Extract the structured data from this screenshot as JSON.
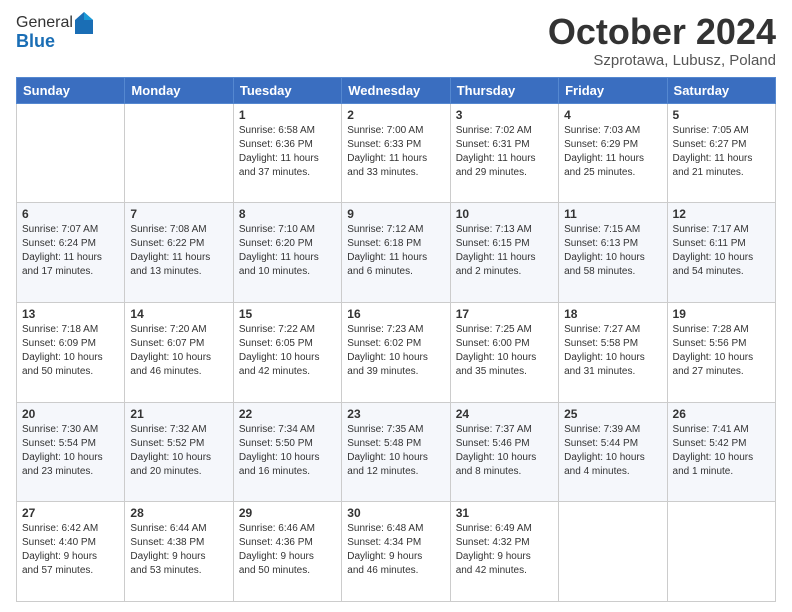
{
  "logo": {
    "general": "General",
    "blue": "Blue"
  },
  "header": {
    "month": "October 2024",
    "location": "Szprotawa, Lubusz, Poland"
  },
  "days": [
    "Sunday",
    "Monday",
    "Tuesday",
    "Wednesday",
    "Thursday",
    "Friday",
    "Saturday"
  ],
  "weeks": [
    [
      {
        "day": "",
        "content": ""
      },
      {
        "day": "",
        "content": ""
      },
      {
        "day": "1",
        "content": "Sunrise: 6:58 AM\nSunset: 6:36 PM\nDaylight: 11 hours\nand 37 minutes."
      },
      {
        "day": "2",
        "content": "Sunrise: 7:00 AM\nSunset: 6:33 PM\nDaylight: 11 hours\nand 33 minutes."
      },
      {
        "day": "3",
        "content": "Sunrise: 7:02 AM\nSunset: 6:31 PM\nDaylight: 11 hours\nand 29 minutes."
      },
      {
        "day": "4",
        "content": "Sunrise: 7:03 AM\nSunset: 6:29 PM\nDaylight: 11 hours\nand 25 minutes."
      },
      {
        "day": "5",
        "content": "Sunrise: 7:05 AM\nSunset: 6:27 PM\nDaylight: 11 hours\nand 21 minutes."
      }
    ],
    [
      {
        "day": "6",
        "content": "Sunrise: 7:07 AM\nSunset: 6:24 PM\nDaylight: 11 hours\nand 17 minutes."
      },
      {
        "day": "7",
        "content": "Sunrise: 7:08 AM\nSunset: 6:22 PM\nDaylight: 11 hours\nand 13 minutes."
      },
      {
        "day": "8",
        "content": "Sunrise: 7:10 AM\nSunset: 6:20 PM\nDaylight: 11 hours\nand 10 minutes."
      },
      {
        "day": "9",
        "content": "Sunrise: 7:12 AM\nSunset: 6:18 PM\nDaylight: 11 hours\nand 6 minutes."
      },
      {
        "day": "10",
        "content": "Sunrise: 7:13 AM\nSunset: 6:15 PM\nDaylight: 11 hours\nand 2 minutes."
      },
      {
        "day": "11",
        "content": "Sunrise: 7:15 AM\nSunset: 6:13 PM\nDaylight: 10 hours\nand 58 minutes."
      },
      {
        "day": "12",
        "content": "Sunrise: 7:17 AM\nSunset: 6:11 PM\nDaylight: 10 hours\nand 54 minutes."
      }
    ],
    [
      {
        "day": "13",
        "content": "Sunrise: 7:18 AM\nSunset: 6:09 PM\nDaylight: 10 hours\nand 50 minutes."
      },
      {
        "day": "14",
        "content": "Sunrise: 7:20 AM\nSunset: 6:07 PM\nDaylight: 10 hours\nand 46 minutes."
      },
      {
        "day": "15",
        "content": "Sunrise: 7:22 AM\nSunset: 6:05 PM\nDaylight: 10 hours\nand 42 minutes."
      },
      {
        "day": "16",
        "content": "Sunrise: 7:23 AM\nSunset: 6:02 PM\nDaylight: 10 hours\nand 39 minutes."
      },
      {
        "day": "17",
        "content": "Sunrise: 7:25 AM\nSunset: 6:00 PM\nDaylight: 10 hours\nand 35 minutes."
      },
      {
        "day": "18",
        "content": "Sunrise: 7:27 AM\nSunset: 5:58 PM\nDaylight: 10 hours\nand 31 minutes."
      },
      {
        "day": "19",
        "content": "Sunrise: 7:28 AM\nSunset: 5:56 PM\nDaylight: 10 hours\nand 27 minutes."
      }
    ],
    [
      {
        "day": "20",
        "content": "Sunrise: 7:30 AM\nSunset: 5:54 PM\nDaylight: 10 hours\nand 23 minutes."
      },
      {
        "day": "21",
        "content": "Sunrise: 7:32 AM\nSunset: 5:52 PM\nDaylight: 10 hours\nand 20 minutes."
      },
      {
        "day": "22",
        "content": "Sunrise: 7:34 AM\nSunset: 5:50 PM\nDaylight: 10 hours\nand 16 minutes."
      },
      {
        "day": "23",
        "content": "Sunrise: 7:35 AM\nSunset: 5:48 PM\nDaylight: 10 hours\nand 12 minutes."
      },
      {
        "day": "24",
        "content": "Sunrise: 7:37 AM\nSunset: 5:46 PM\nDaylight: 10 hours\nand 8 minutes."
      },
      {
        "day": "25",
        "content": "Sunrise: 7:39 AM\nSunset: 5:44 PM\nDaylight: 10 hours\nand 4 minutes."
      },
      {
        "day": "26",
        "content": "Sunrise: 7:41 AM\nSunset: 5:42 PM\nDaylight: 10 hours\nand 1 minute."
      }
    ],
    [
      {
        "day": "27",
        "content": "Sunrise: 6:42 AM\nSunset: 4:40 PM\nDaylight: 9 hours\nand 57 minutes."
      },
      {
        "day": "28",
        "content": "Sunrise: 6:44 AM\nSunset: 4:38 PM\nDaylight: 9 hours\nand 53 minutes."
      },
      {
        "day": "29",
        "content": "Sunrise: 6:46 AM\nSunset: 4:36 PM\nDaylight: 9 hours\nand 50 minutes."
      },
      {
        "day": "30",
        "content": "Sunrise: 6:48 AM\nSunset: 4:34 PM\nDaylight: 9 hours\nand 46 minutes."
      },
      {
        "day": "31",
        "content": "Sunrise: 6:49 AM\nSunset: 4:32 PM\nDaylight: 9 hours\nand 42 minutes."
      },
      {
        "day": "",
        "content": ""
      },
      {
        "day": "",
        "content": ""
      }
    ]
  ]
}
